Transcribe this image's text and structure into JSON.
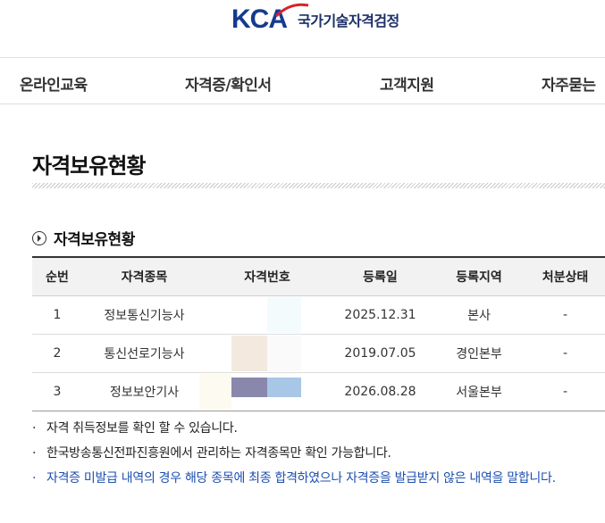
{
  "header": {
    "logo_mark": "KCA",
    "logo_text": "국가기술자격검정"
  },
  "nav": {
    "items": [
      {
        "label": "온라인교육"
      },
      {
        "label": "자격증/확인서"
      },
      {
        "label": "고객지원"
      },
      {
        "label": "자주묻는"
      }
    ]
  },
  "page": {
    "title": "자격보유현황"
  },
  "section": {
    "title": "자격보유현황",
    "icon": "circle-arrow-right-icon"
  },
  "table": {
    "headers": [
      "순번",
      "자격종목",
      "자격번호",
      "등록일",
      "등록지역",
      "처분상태"
    ],
    "rows": [
      {
        "no": "1",
        "item": "정보통신기능사",
        "number": "",
        "date": "2025.12.31",
        "region": "본사",
        "status": "-"
      },
      {
        "no": "2",
        "item": "통신선로기능사",
        "number": "",
        "date": "2019.07.05",
        "region": "경인본부",
        "status": "-"
      },
      {
        "no": "3",
        "item": "정보보안기사",
        "number": "",
        "date": "2026.08.28",
        "region": "서울본부",
        "status": "-"
      }
    ]
  },
  "notes": [
    {
      "text": "자격 취득정보를 확인 할 수 있습니다."
    },
    {
      "text": "한국방송통신전파진흥원에서 관리하는 자격종목만 확인 가능합니다."
    },
    {
      "text": "자격증 미발급 내역의 경우 해당 종목에 최종 합격하였으나 자격증을 발급받지 않은 내역을 말합니다."
    }
  ],
  "colors": {
    "brand_navy": "#143b8f",
    "brand_red": "#d8222a",
    "note_blue": "#1d4fb0"
  }
}
